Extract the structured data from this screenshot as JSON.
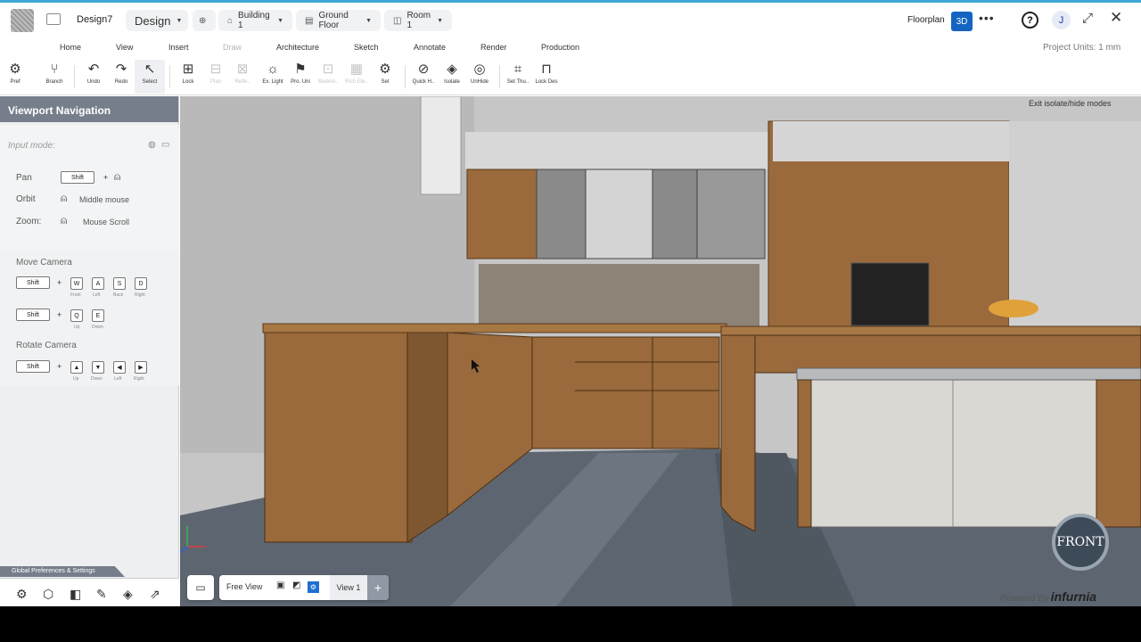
{
  "header": {
    "doc_name": "Design7",
    "mode": "Design",
    "building": "Building 1",
    "floor": "Ground Floor",
    "room": "Room 1",
    "floorplan": "Floorplan",
    "view3d": "3D",
    "more": "•••",
    "help": "?",
    "avatar": "J",
    "expand": "⤢",
    "close": "✕"
  },
  "menu": [
    "Home",
    "View",
    "Insert",
    "Draw",
    "Architecture",
    "Sketch",
    "Annotate",
    "Render",
    "Production"
  ],
  "project_units": "Project Units:   1 mm",
  "toolbar": [
    {
      "label": "Pref",
      "icon": "⚙"
    },
    {
      "label": "Branch",
      "icon": "⑂"
    },
    {
      "label": "Undo",
      "icon": "↶"
    },
    {
      "label": "Redo",
      "icon": "↷"
    },
    {
      "label": "Select",
      "icon": "↖"
    },
    {
      "label": "Lock",
      "icon": "⊞"
    },
    {
      "label": "Plan",
      "icon": "⊟"
    },
    {
      "label": "Refle..",
      "icon": "⊠"
    },
    {
      "label": "Ex. Light",
      "icon": "☼"
    },
    {
      "label": "Pro. Uni",
      "icon": "⚑"
    },
    {
      "label": "Skeleto..",
      "icon": "⊡"
    },
    {
      "label": "Rich Ele..",
      "icon": "▦"
    },
    {
      "label": "Set",
      "icon": "⚙"
    },
    {
      "label": "Quick H..",
      "icon": "⊘"
    },
    {
      "label": "Isolate",
      "icon": "◈"
    },
    {
      "label": "UnHide",
      "icon": "◎"
    },
    {
      "label": "Set Thu..",
      "icon": "⌗"
    },
    {
      "label": "Lock Des",
      "icon": "⊓"
    }
  ],
  "panel": {
    "title": "Viewport Navigation",
    "input_mode": "Input mode:",
    "pan": "Pan",
    "orbit": "Orbit",
    "zoom": "Zoom:",
    "shift": "Shift",
    "middle_mouse": "Middle mouse",
    "mouse_scroll": "Mouse Scroll",
    "move_camera": "Move Camera",
    "rotate_camera": "Rotate Camera",
    "move_keys": [
      {
        "key": "W",
        "sub": "Front"
      },
      {
        "key": "A",
        "sub": "Left"
      },
      {
        "key": "S",
        "sub": "Back"
      },
      {
        "key": "D",
        "sub": "Right"
      }
    ],
    "updown_keys": [
      {
        "key": "Q",
        "sub": "Up"
      },
      {
        "key": "E",
        "sub": "Down"
      }
    ],
    "arrow_keys": [
      {
        "key": "▲",
        "sub": "Up"
      },
      {
        "key": "▼",
        "sub": "Down"
      },
      {
        "key": "◀",
        "sub": "Left"
      },
      {
        "key": "▶",
        "sub": "Right"
      }
    ],
    "global_prefs": "Global Preferences & Settings"
  },
  "viewport": {
    "exit_modes": "Exit isolate/hide modes",
    "front": "FRONT",
    "powered_by": "Powered By",
    "brand": "infurnia",
    "free_view": "Free View",
    "view1": "View 1",
    "add": "+"
  }
}
